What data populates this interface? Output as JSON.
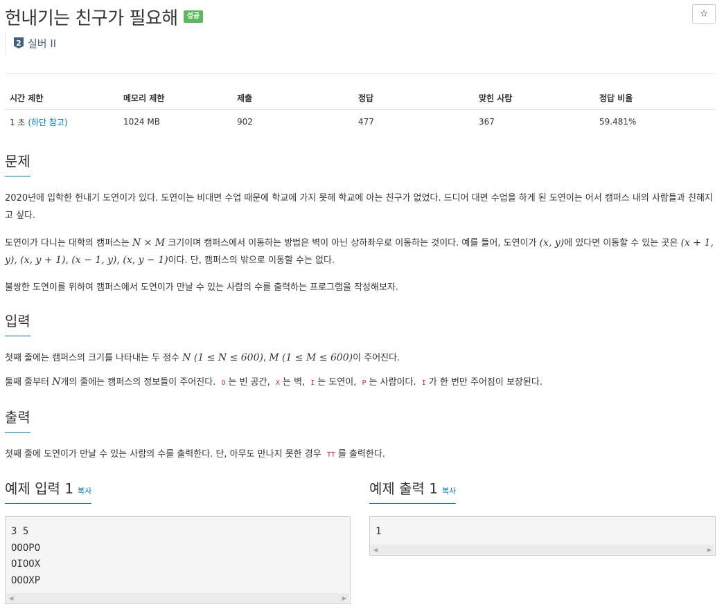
{
  "header": {
    "title": "헌내기는 친구가 필요해",
    "badge": "성공",
    "star": "☆",
    "tier_number": "2",
    "tier_label": "실버 II"
  },
  "stats": {
    "headers": [
      "시간 제한",
      "메모리 제한",
      "제출",
      "정답",
      "맞힌 사람",
      "정답 비율"
    ],
    "time_value": "1 초 ",
    "time_note": "(하단 참고)",
    "memory": "1024 MB",
    "submissions": "902",
    "accepted": "477",
    "solvers": "367",
    "ratio": "59.481%"
  },
  "problem": {
    "heading": "문제",
    "p1": "2020년에 입학한 헌내기 도연이가 있다. 도연이는 비대면 수업 때문에 학교에 가지 못해 학교에 아는 친구가 없었다. 드디어 대면 수업을 하게 된 도연이는 어서 캠퍼스 내의 사람들과 친해지고 싶다.",
    "p2_a": "도연이가 다니는 대학의 캠퍼스는 ",
    "p2_math1": "N × M",
    "p2_b": " 크기이며 캠퍼스에서 이동하는 방법은 벽이 아닌 상하좌우로 이동하는 것이다. 예를 들어, 도연이가 ",
    "p2_math2": "(x, y)",
    "p2_c": "에 있다면 이동할 수 있는 곳은 ",
    "p2_math3": "(x + 1, y), (x, y + 1), (x − 1, y), (x, y − 1)",
    "p2_d": "이다. 단, 캠퍼스의 밖으로 이동할 수는 없다.",
    "p3": "불쌍한 도연이를 위하여 캠퍼스에서 도연이가 만날 수 있는 사람의 수를 출력하는 프로그램을 작성해보자."
  },
  "input": {
    "heading": "입력",
    "l1_a": "첫째 줄에는 캠퍼스의 크기를 나타내는 두 정수 ",
    "l1_math1": "N (1 ≤ N ≤ 600)",
    "l1_sep": ", ",
    "l1_math2": "M (1 ≤ M ≤ 600)",
    "l1_b": "이 주어진다.",
    "l2_a": "둘째 줄부터 ",
    "l2_math": "N",
    "l2_b": "개의 줄에는 캠퍼스의 정보들이 주어진다. ",
    "code_o": "O",
    "l2_c": "는 빈 공간, ",
    "code_x": "X",
    "l2_d": "는 벽, ",
    "code_i": "I",
    "l2_e": "는 도연이, ",
    "code_p": "P",
    "l2_f": "는 사람이다. ",
    "code_i2": "I",
    "l2_g": "가 한 번만 주어짐이 보장된다."
  },
  "output": {
    "heading": "출력",
    "l1_a": "첫째 줄에 도연이가 만날 수 있는 사람의 수를 출력한다. 단, 아무도 만나지 못한 경우 ",
    "code_tt": "TT",
    "l1_b": "를 출력한다."
  },
  "examples": {
    "input_heading": "예제 입력 1",
    "output_heading": "예제 출력 1",
    "copy_label": "복사",
    "input_text": "3 5\nOOOPO\nOIOOX\nOOOXP",
    "output_text": "1",
    "scroll_left": "◀",
    "scroll_right": "▶"
  }
}
